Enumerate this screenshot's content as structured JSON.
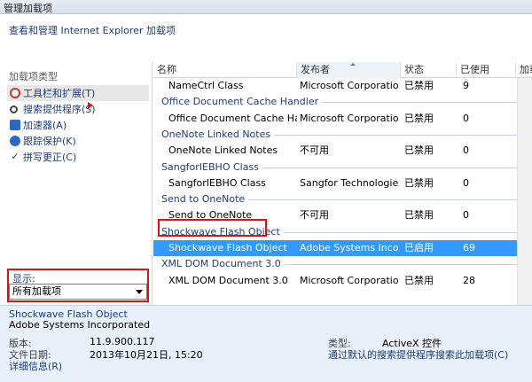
{
  "window": {
    "title": "管理加载项"
  },
  "subtitle": "查看和管理 Internet Explorer 加载项",
  "left": {
    "heading": "加载项类型",
    "items": [
      {
        "label": "工具栏和扩展(T)",
        "icon": "toolbar-extension-icon",
        "selected": true
      },
      {
        "label": "搜索提供程序(S)",
        "icon": "search-icon",
        "selected": false
      },
      {
        "label": "加速器(A)",
        "icon": "accelerator-icon",
        "selected": false
      },
      {
        "label": "跟踪保护(K)",
        "icon": "tracking-protection-icon",
        "selected": false
      },
      {
        "label": "拼写更正(C)",
        "icon": "spelling-icon",
        "selected": false
      }
    ],
    "show_label": "显示:",
    "show_value": "所有加载项"
  },
  "grid": {
    "columns": [
      "名称",
      "发布者",
      "状态",
      "已使用",
      "加载"
    ],
    "rows": [
      {
        "type": "row",
        "name": "NameCtrl Class",
        "publisher": "Microsoft Corporation",
        "status": "已禁用",
        "used": "9"
      },
      {
        "type": "group",
        "name": "Office Document Cache Handler"
      },
      {
        "type": "row",
        "name": "Office Document Cache Handl...",
        "publisher": "Microsoft Corporation",
        "status": "已禁用",
        "used": "0"
      },
      {
        "type": "group",
        "name": "OneNote Linked Notes"
      },
      {
        "type": "row",
        "name": "OneNote Linked Notes",
        "publisher": "不可用",
        "status": "已禁用",
        "used": "0"
      },
      {
        "type": "group",
        "name": "SangforIEBHO Class"
      },
      {
        "type": "row",
        "name": "SangforIEBHO Class",
        "publisher": "Sangfor Technologies ...",
        "status": "已禁用",
        "used": "0"
      },
      {
        "type": "group",
        "name": "Send to OneNote"
      },
      {
        "type": "row",
        "name": "Send to OneNote",
        "publisher": "不可用",
        "status": "已禁用",
        "used": "0"
      },
      {
        "type": "group",
        "name": "Shockwave Flash Object"
      },
      {
        "type": "row",
        "name": "Shockwave Flash Object",
        "publisher": "Adobe Systems Incorp...",
        "status": "已启用",
        "used": "69",
        "selected": true
      },
      {
        "type": "group",
        "name": "XML DOM Document 3.0"
      },
      {
        "type": "row",
        "name": "XML DOM Document 3.0",
        "publisher": "Microsoft Corporation",
        "status": "已禁用",
        "used": "28"
      }
    ]
  },
  "details": {
    "name": "Shockwave Flash Object",
    "publisher": "Adobe Systems Incorporated",
    "version_label": "版本:",
    "version": "11.9.900.117",
    "date_label": "文件日期:",
    "date": "2013年10月21日, 15:20",
    "more_info": "详细信息(R)",
    "type_label": "类型:",
    "type": "ActiveX 控件",
    "search_link": "通过默认的搜索提供程序搜索此加载项(C)"
  },
  "colors": {
    "accent": "#1e3d7a",
    "selection": "#3399ff",
    "highlight_box": "#dd1111"
  }
}
